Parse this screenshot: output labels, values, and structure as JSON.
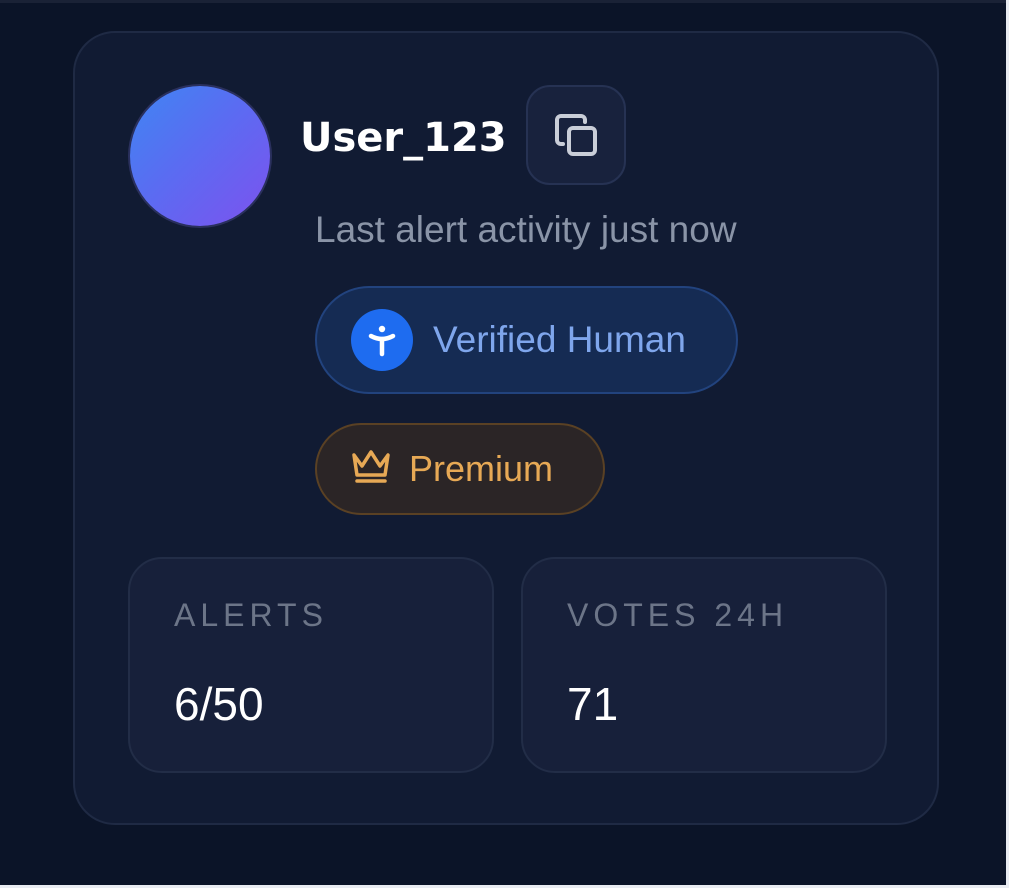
{
  "profile": {
    "username": "User_123",
    "activity": "Last alert activity just now",
    "avatar_gradient": [
      "#3f86f3",
      "#7d52ee"
    ]
  },
  "actions": {
    "copy_icon": "copy-icon"
  },
  "badges": {
    "verified": {
      "label": "Verified Human",
      "icon": "person-icon",
      "color": "#1e6cf0"
    },
    "premium": {
      "label": "Premium",
      "icon": "crown-icon",
      "color": "#e7a955"
    }
  },
  "stats": [
    {
      "label": "ALERTS",
      "value": "6/50"
    },
    {
      "label": "VOTES 24H",
      "value": "71"
    }
  ],
  "colors": {
    "background": "#0b1428",
    "card": "#111b33",
    "text_muted": "#8a94a7"
  }
}
